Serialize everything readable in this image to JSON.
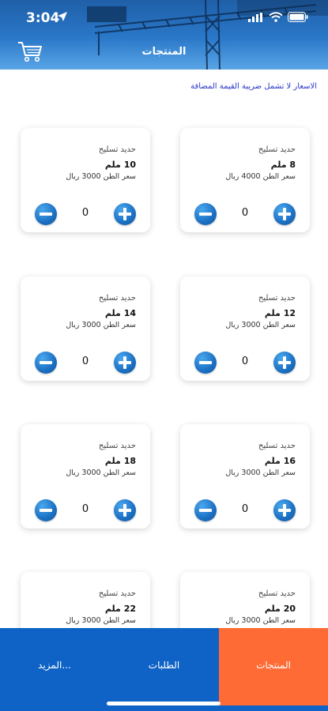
{
  "status": {
    "time": "3:04"
  },
  "header": {
    "title": "المنتجات"
  },
  "notice": "الاسعار لا تشمل ضريبة القيمة المضافة",
  "products": [
    {
      "category": "حديد تسليح",
      "size": "8 ملم",
      "price": "سعر الطن 4000 ريال",
      "qty": "0"
    },
    {
      "category": "حديد تسليح",
      "size": "10 ملم",
      "price": "سعر الطن 3000 ريال",
      "qty": "0"
    },
    {
      "category": "حديد تسليح",
      "size": "12 ملم",
      "price": "سعر الطن 3000 ريال",
      "qty": "0"
    },
    {
      "category": "حديد تسليح",
      "size": "14 ملم",
      "price": "سعر الطن 3000 ريال",
      "qty": "0"
    },
    {
      "category": "حديد تسليح",
      "size": "16 ملم",
      "price": "سعر الطن 3000 ريال",
      "qty": "0"
    },
    {
      "category": "حديد تسليح",
      "size": "18 ملم",
      "price": "سعر الطن 3000 ريال",
      "qty": "0"
    },
    {
      "category": "حديد تسليح",
      "size": "20 ملم",
      "price": "سعر الطن 3000 ريال",
      "qty": ""
    },
    {
      "category": "حديد تسليح",
      "size": "22 ملم",
      "price": "سعر الطن 3000 ريال",
      "qty": ""
    }
  ],
  "tabs": {
    "products": "المنتجات",
    "orders": "الطلبات",
    "more": "المزيد..."
  },
  "colors": {
    "primary": "#0f63c6",
    "active_tab": "#ff6b35"
  }
}
